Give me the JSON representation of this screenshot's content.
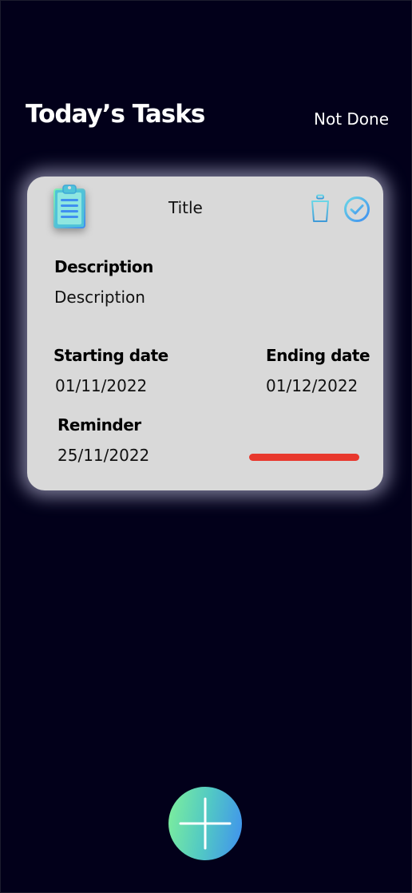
{
  "header": {
    "title": "Today’s Tasks",
    "filter": "Not Done"
  },
  "task": {
    "title": "Title",
    "description_label": "Description",
    "description_value": "Description",
    "start_label": "Starting date",
    "start_value": "01/11/2022",
    "end_label": "Ending date",
    "end_value": "01/12/2022",
    "reminder_label": "Reminder",
    "reminder_value": "25/11/2022",
    "priority_color": "#e8382d"
  },
  "icons": {
    "task": "clipboard-icon",
    "delete": "trash-icon",
    "complete": "check-circle-icon",
    "add": "plus-icon"
  },
  "colors": {
    "background": "#02001a",
    "card": "#d9d9d9",
    "icon_gradient_start": "#7ff09a",
    "icon_gradient_end": "#3f8ff0"
  }
}
